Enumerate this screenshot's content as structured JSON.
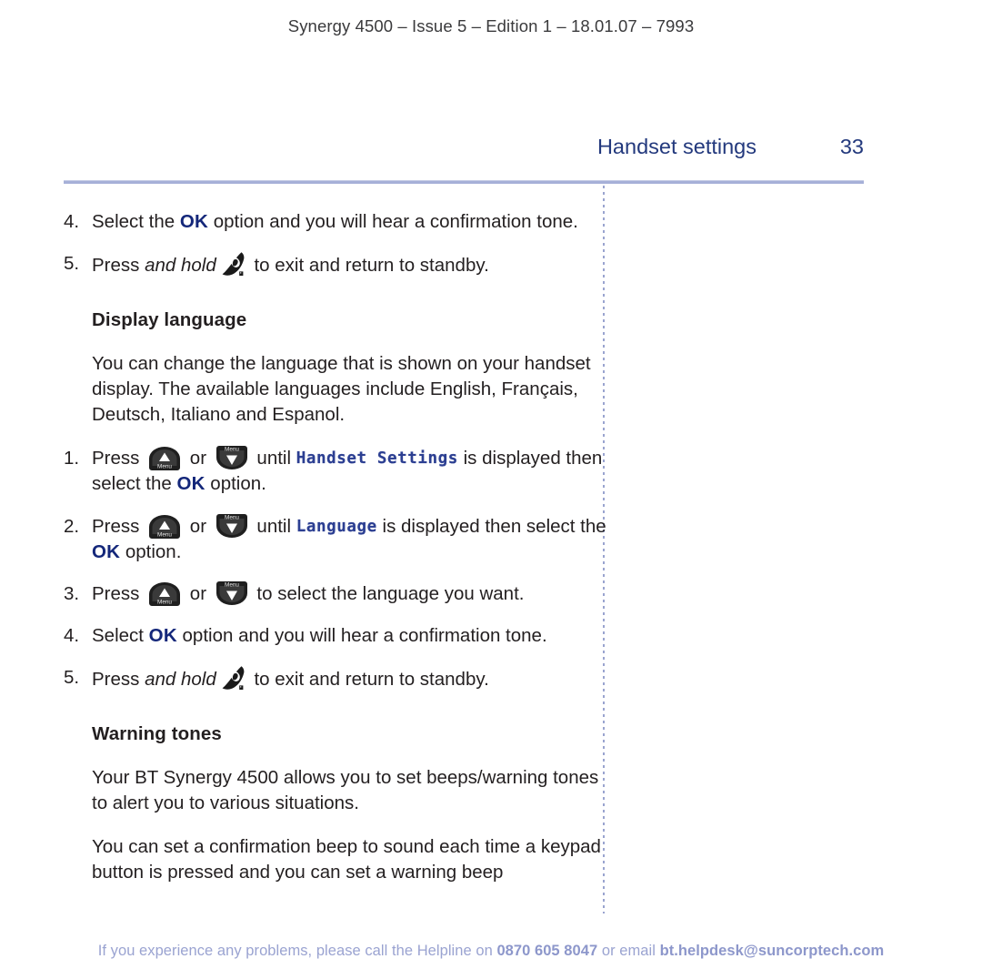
{
  "document": {
    "running_header": "Synergy 4500 – Issue 5 –  Edition 1 – 18.01.07 – 7993",
    "section_title": "Handset settings",
    "page_number": "33"
  },
  "content": {
    "step_4a": {
      "number": "4.",
      "text_before": "Select the ",
      "ok_label": "OK",
      "text_after": " option and you will hear a confirmation tone."
    },
    "step_5a": {
      "number": "5.",
      "press_label": "Press ",
      "and_hold": "and hold",
      "icon": "hangup-key-icon",
      "text_after": " to exit and return to standby."
    },
    "display_language": {
      "heading": "Display language",
      "intro": "You can change the language that is shown on your handset display. The available languages include English, Français, Deutsch, Italiano and Espanol.",
      "steps": [
        {
          "number": "1.",
          "press_label": "Press ",
          "icon_up": "menu-up-key-icon",
          "or_label": " or ",
          "icon_down": "menu-down-key-icon",
          "until_label": " until ",
          "lcd_text": "Handset Settings",
          "mid_label": " is displayed then select the ",
          "ok_label": "OK",
          "end_label": " option."
        },
        {
          "number": "2.",
          "press_label": "Press ",
          "icon_up": "menu-up-key-icon",
          "or_label": " or ",
          "icon_down": "menu-down-key-icon",
          "until_label": " until ",
          "lcd_text": "Language",
          "mid_label": " is displayed then select the ",
          "ok_label": "OK",
          "end_label": " option."
        },
        {
          "number": "3.",
          "press_label": "Press ",
          "icon_up": "menu-up-key-icon",
          "or_label": " or ",
          "icon_down": "menu-down-key-icon",
          "end_label": " to select the language you want."
        },
        {
          "number": "4.",
          "text_before": "Select ",
          "ok_label": "OK",
          "text_after": " option and you will hear a confirmation tone."
        },
        {
          "number": "5.",
          "press_label": "Press ",
          "and_hold": "and hold",
          "icon": "hangup-key-icon",
          "text_after": " to exit and return to standby."
        }
      ]
    },
    "warning_tones": {
      "heading": "Warning tones",
      "paragraph_1": "Your BT Synergy 4500 allows you to set beeps/warning tones to alert you to various situations.",
      "paragraph_2": "You can set a confirmation beep to sound each time a keypad button is pressed and you can set a warning beep"
    }
  },
  "footer": {
    "text_1": "If you experience any problems, please call the Helpline on ",
    "phone": "0870 605 8047",
    "text_2": " or email ",
    "email": "bt.helpdesk@suncorptech.com"
  },
  "icon_labels": {
    "menu": "Menu"
  },
  "colors": {
    "accent_blue": "#23397d",
    "ok_blue": "#14277a",
    "lcd_blue": "#2c3f92",
    "rule_blue": "#a6b0d8",
    "footer_blue": "#9aa3d1"
  }
}
